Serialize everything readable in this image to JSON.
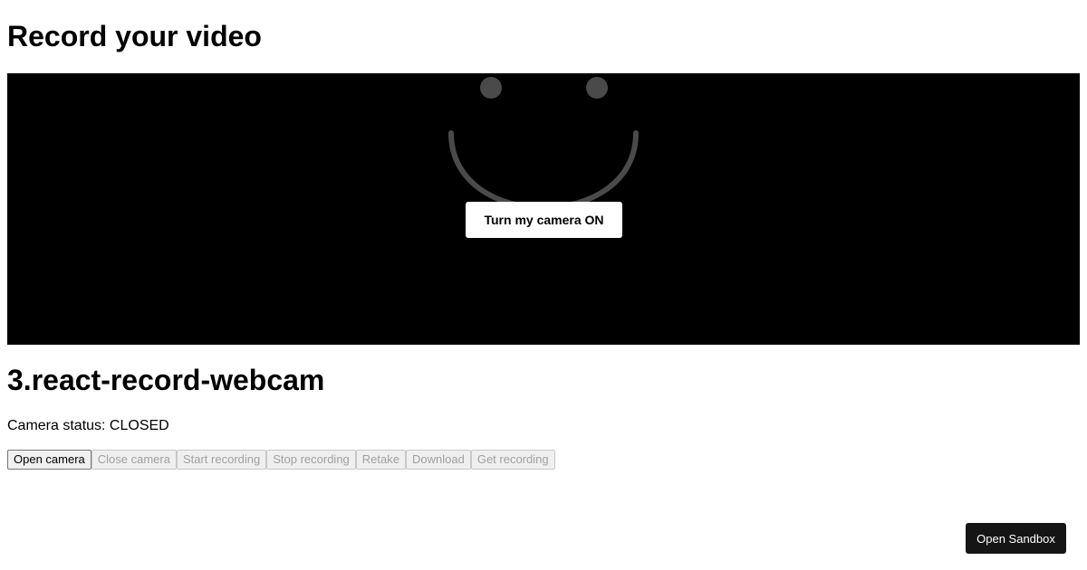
{
  "header": {
    "title": "Record your video"
  },
  "video": {
    "turn_on_label": "Turn my camera ON",
    "background_color": "#000000",
    "face_color": "#4a4a4a",
    "face_icon": "smiley-face-icon"
  },
  "section": {
    "title": "3.react-record-webcam"
  },
  "status": {
    "text": "Camera status: CLOSED"
  },
  "controls": {
    "open_camera": "Open camera",
    "close_camera": "Close camera",
    "start_recording": "Start recording",
    "stop_recording": "Stop recording",
    "retake": "Retake",
    "download": "Download",
    "get_recording": "Get recording"
  },
  "sandbox": {
    "label": "Open Sandbox",
    "background_color": "#151515"
  }
}
